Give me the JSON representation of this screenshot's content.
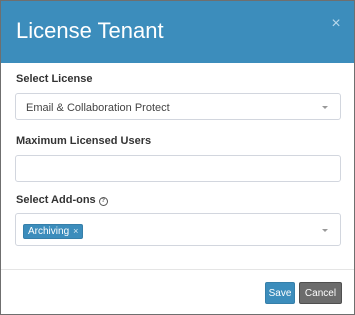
{
  "dialog": {
    "title": "License Tenant",
    "close_symbol": "×"
  },
  "select_license": {
    "label": "Select License",
    "value": "Email & Collaboration Protect",
    "icon": "chevron-down-icon"
  },
  "max_users": {
    "label": "Maximum Licensed Users",
    "value": ""
  },
  "addons": {
    "label": "Select Add-ons",
    "help_symbol": "?",
    "tags": [
      "Archiving"
    ],
    "tag_remove_symbol": "×"
  },
  "footer": {
    "save_label": "Save",
    "cancel_label": "Cancel"
  },
  "colors": {
    "header": "#3c8dbc",
    "save_button": "#3c8dbc",
    "cancel_button": "#6c6c6c",
    "tag": "#3c8dbc"
  }
}
